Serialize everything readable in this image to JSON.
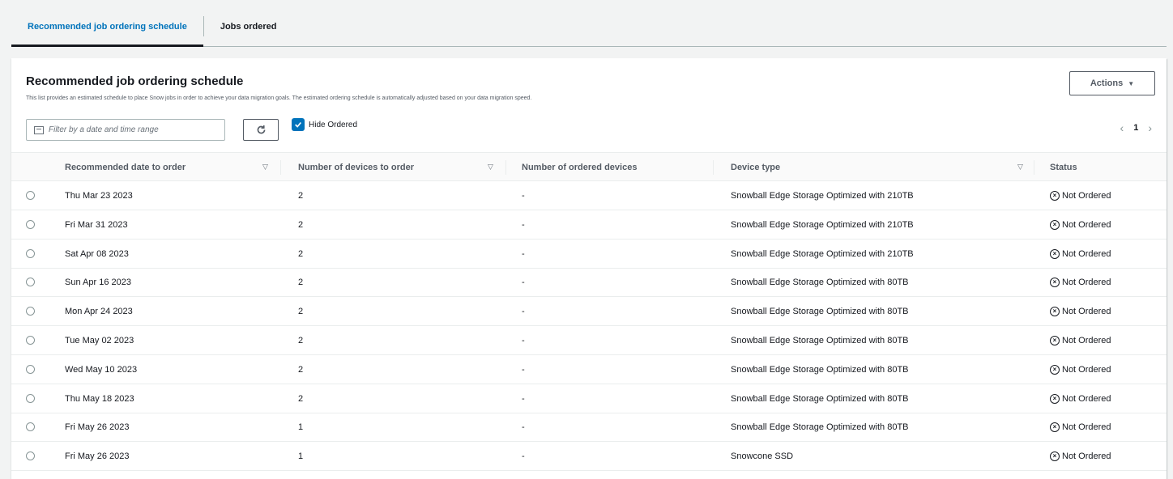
{
  "tabs": [
    {
      "label": "Recommended job ordering schedule",
      "active": true
    },
    {
      "label": "Jobs ordered",
      "active": false
    }
  ],
  "panel": {
    "title": "Recommended job ordering schedule",
    "description": "This list provides an estimated schedule to place Snow jobs in order to achieve your data migration goals. The estimated ordering schedule is automatically adjusted based on your data migration speed.",
    "actions_label": "Actions",
    "filter_placeholder": "Filter by a date and time range",
    "hide_ordered_label": "Hide Ordered",
    "hide_ordered_checked": true,
    "current_page": "1"
  },
  "table": {
    "columns": [
      "Recommended date to order",
      "Number of devices to order",
      "Number of ordered devices",
      "Device type",
      "Status"
    ],
    "rows": [
      {
        "date": "Thu Mar 23 2023",
        "devices": "2",
        "ordered": "-",
        "device_type": "Snowball Edge Storage Optimized with 210TB",
        "status": "Not Ordered"
      },
      {
        "date": "Fri Mar 31 2023",
        "devices": "2",
        "ordered": "-",
        "device_type": "Snowball Edge Storage Optimized with 210TB",
        "status": "Not Ordered"
      },
      {
        "date": "Sat Apr 08 2023",
        "devices": "2",
        "ordered": "-",
        "device_type": "Snowball Edge Storage Optimized with 210TB",
        "status": "Not Ordered"
      },
      {
        "date": "Sun Apr 16 2023",
        "devices": "2",
        "ordered": "-",
        "device_type": "Snowball Edge Storage Optimized with 80TB",
        "status": "Not Ordered"
      },
      {
        "date": "Mon Apr 24 2023",
        "devices": "2",
        "ordered": "-",
        "device_type": "Snowball Edge Storage Optimized with 80TB",
        "status": "Not Ordered"
      },
      {
        "date": "Tue May 02 2023",
        "devices": "2",
        "ordered": "-",
        "device_type": "Snowball Edge Storage Optimized with 80TB",
        "status": "Not Ordered"
      },
      {
        "date": "Wed May 10 2023",
        "devices": "2",
        "ordered": "-",
        "device_type": "Snowball Edge Storage Optimized with 80TB",
        "status": "Not Ordered"
      },
      {
        "date": "Thu May 18 2023",
        "devices": "2",
        "ordered": "-",
        "device_type": "Snowball Edge Storage Optimized with 80TB",
        "status": "Not Ordered"
      },
      {
        "date": "Fri May 26 2023",
        "devices": "1",
        "ordered": "-",
        "device_type": "Snowball Edge Storage Optimized with 80TB",
        "status": "Not Ordered"
      },
      {
        "date": "Fri May 26 2023",
        "devices": "1",
        "ordered": "-",
        "device_type": "Snowcone SSD",
        "status": "Not Ordered"
      }
    ]
  },
  "colors": {
    "accent": "#0073bb",
    "text": "#16191f",
    "muted": "#545b64",
    "border": "#eaeded"
  }
}
